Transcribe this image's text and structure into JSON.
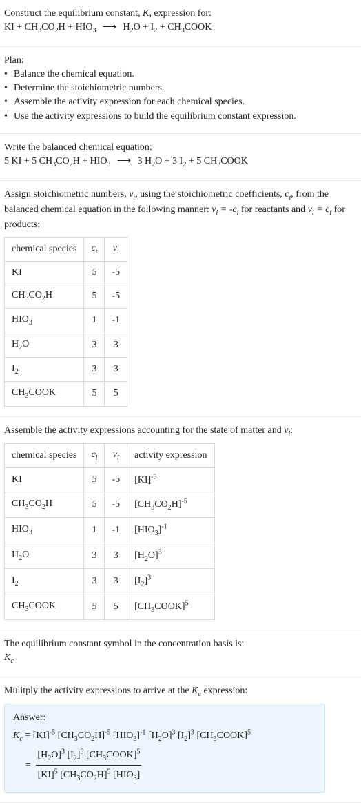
{
  "intro": {
    "construct": "Construct the equilibrium constant, ",
    "K": "K",
    "construct2": ", expression for:",
    "eq_lhs": "KI + CH_3CO_2H + HIO_3",
    "arrow": "⟶",
    "eq_rhs": "H_2O + I_2 + CH_3COOK"
  },
  "plan": {
    "title": "Plan:",
    "items": [
      "Balance the chemical equation.",
      "Determine the stoichiometric numbers.",
      "Assemble the activity expression for each chemical species.",
      "Use the activity expressions to build the equilibrium constant expression."
    ]
  },
  "balanced": {
    "intro": "Write the balanced chemical equation:",
    "lhs": "5 KI + 5 CH_3CO_2H + HIO_3",
    "arrow": "⟶",
    "rhs": "3 H_2O + 3 I_2 + 5 CH_3COOK"
  },
  "assign": {
    "p1a": "Assign stoichiometric numbers, ",
    "nu": "ν_i",
    "p1b": ", using the stoichiometric coefficients, ",
    "ci": "c_i",
    "p1c": ", from the balanced chemical equation in the following manner: ",
    "rel1": "ν_i = -c_i",
    "p1d": " for reactants and ",
    "rel2": "ν_i = c_i",
    "p1e": " for products:",
    "headers": {
      "species": "chemical species",
      "c": "c_i",
      "nu": "ν_i"
    },
    "rows": [
      {
        "species": "KI",
        "c": "5",
        "nu": "-5"
      },
      {
        "species": "CH_3CO_2H",
        "c": "5",
        "nu": "-5"
      },
      {
        "species": "HIO_3",
        "c": "1",
        "nu": "-1"
      },
      {
        "species": "H_2O",
        "c": "3",
        "nu": "3"
      },
      {
        "species": "I_2",
        "c": "3",
        "nu": "3"
      },
      {
        "species": "CH_3COOK",
        "c": "5",
        "nu": "5"
      }
    ]
  },
  "activity": {
    "intro": "Assemble the activity expressions accounting for the state of matter and ",
    "nu": "ν_i",
    "colon": ":",
    "headers": {
      "species": "chemical species",
      "c": "c_i",
      "nu": "ν_i",
      "act": "activity expression"
    },
    "rows": [
      {
        "species": "KI",
        "c": "5",
        "nu": "-5",
        "base": "[KI]",
        "exp": "-5"
      },
      {
        "species": "CH_3CO_2H",
        "c": "5",
        "nu": "-5",
        "base": "[CH_3CO_2H]",
        "exp": "-5"
      },
      {
        "species": "HIO_3",
        "c": "1",
        "nu": "-1",
        "base": "[HIO_3]",
        "exp": "-1"
      },
      {
        "species": "H_2O",
        "c": "3",
        "nu": "3",
        "base": "[H_2O]",
        "exp": "3"
      },
      {
        "species": "I_2",
        "c": "3",
        "nu": "3",
        "base": "[I_2]",
        "exp": "3"
      },
      {
        "species": "CH_3COOK",
        "c": "5",
        "nu": "5",
        "base": "[CH_3COOK]",
        "exp": "5"
      }
    ]
  },
  "kc_symbol": {
    "line1": "The equilibrium constant symbol in the concentration basis is:",
    "kc": "K_c"
  },
  "multiply": {
    "intro1": "Mulitply the activity expressions to arrive at the ",
    "kc": "K_c",
    "intro2": " expression:"
  },
  "answer": {
    "label": "Answer:",
    "kc": "K_c",
    "terms": [
      {
        "base": "[KI]",
        "exp": "-5"
      },
      {
        "base": "[CH_3CO_2H]",
        "exp": "-5"
      },
      {
        "base": "[HIO_3]",
        "exp": "-1"
      },
      {
        "base": "[H_2O]",
        "exp": "3"
      },
      {
        "base": "[I_2]",
        "exp": "3"
      },
      {
        "base": "[CH_3COOK]",
        "exp": "5"
      }
    ],
    "num": [
      {
        "base": "[H_2O]",
        "exp": "3"
      },
      {
        "base": "[I_2]",
        "exp": "3"
      },
      {
        "base": "[CH_3COOK]",
        "exp": "5"
      }
    ],
    "den": [
      {
        "base": "[KI]",
        "exp": "5"
      },
      {
        "base": "[CH_3CO_2H]",
        "exp": "5"
      },
      {
        "base": "[HIO_3]",
        "exp": ""
      }
    ]
  }
}
